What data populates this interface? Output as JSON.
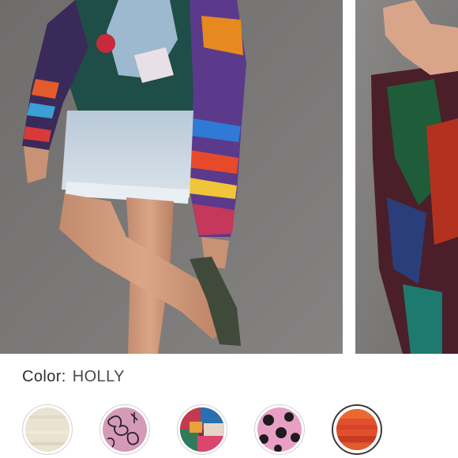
{
  "product": {
    "color_label": "Color:",
    "selected_color": "HOLLY"
  },
  "gallery": {
    "images": [
      {
        "name": "model-front-view",
        "alt": ""
      },
      {
        "name": "model-side-view",
        "alt": ""
      }
    ]
  },
  "swatches": [
    {
      "name": "cream",
      "selected": false,
      "base": "#e9e1cf"
    },
    {
      "name": "pink-floral",
      "selected": false,
      "base": "#d49ab8"
    },
    {
      "name": "abstract-multi",
      "selected": false,
      "base": "#b8334f"
    },
    {
      "name": "pink-dots",
      "selected": false,
      "base": "#e29bc0"
    },
    {
      "name": "holly",
      "selected": true,
      "base": "#e0502a"
    }
  ]
}
